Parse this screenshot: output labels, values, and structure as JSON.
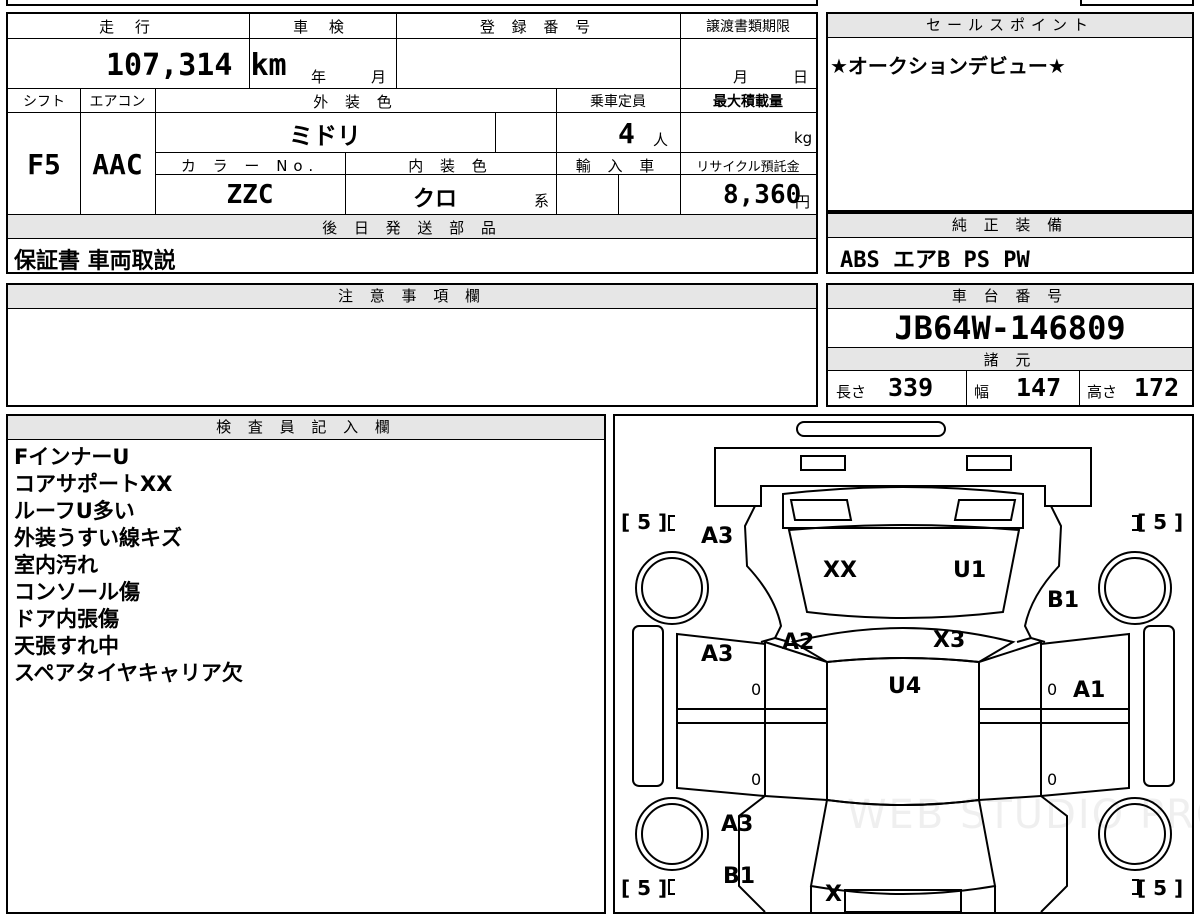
{
  "top_info": {
    "mileage_label": "走 行",
    "mileage_value": "107,314 km",
    "inspection_label": "車 検",
    "inspection_year": "年",
    "inspection_month": "月",
    "registration_label": "登 録 番 号",
    "transfer_label": "譲渡書類期限",
    "transfer_month": "月",
    "transfer_day": "日",
    "shift_label": "シフト",
    "shift_value": "F5",
    "ac_label": "エアコン",
    "ac_value": "AAC",
    "ext_color_label": "外 装 色",
    "ext_color_value": "ミドリ",
    "capacity_label": "乗車定員",
    "capacity_value": "4",
    "capacity_unit": "人",
    "max_load_label": "最大積載量",
    "max_load_unit": "kg",
    "color_no_label": "カ ラ ー No.",
    "color_no_value": "ZZC",
    "int_color_label": "内 装 色",
    "int_color_value": "クロ",
    "int_color_suffix": "系",
    "import_label": "輸 入 車",
    "recycle_label": "リサイクル預託金",
    "recycle_value": "8,360",
    "recycle_unit": "円"
  },
  "sales_point": {
    "label": "セールスポイント",
    "text": "★オークションデビュー★"
  },
  "later_parts": {
    "label": "後 日 発 送 部 品",
    "text": "保証書 車両取説"
  },
  "genuine_equipment": {
    "label": "純 正 装 備",
    "text": "ABS エアB PS PW"
  },
  "caution": {
    "label": "注 意 事 項 欄"
  },
  "chassis": {
    "label": "車 台 番 号",
    "value": "JB64W-146809",
    "spec_label": "諸 元",
    "length_label": "長さ",
    "length_value": "339",
    "width_label": "幅",
    "width_value": "147",
    "height_label": "高さ",
    "height_value": "172"
  },
  "inspector": {
    "label": "検 査 員 記 入 欄",
    "notes": [
      "FインナーU",
      "コアサポートXX",
      "ルーフU多い",
      "外装うすい線キズ",
      "室内汚れ",
      "コンソール傷",
      "ドア内張傷",
      "天張すれ中",
      "スペアタイヤキャリア欠"
    ]
  },
  "diagram": {
    "tire_tl": "[ 5 ]",
    "tire_tr": "[ 5 ]",
    "tire_bl": "[ 5 ]",
    "tire_br": "[ 5 ]",
    "marks": {
      "front_left": "A3",
      "hood_left": "XX",
      "hood_right": "U1",
      "front_right": "B1",
      "pillar_left": "A2",
      "roof_front": "X3",
      "door_front_left": "A3",
      "roof": "U4",
      "door_front_right": "A1",
      "rear_left": "A3",
      "bottom_left": "B1",
      "bottom_center": "X",
      "zero1": "0",
      "zero2": "0",
      "zero3": "0",
      "zero4": "0"
    },
    "watermark": "WEB STUDIO PRO"
  }
}
